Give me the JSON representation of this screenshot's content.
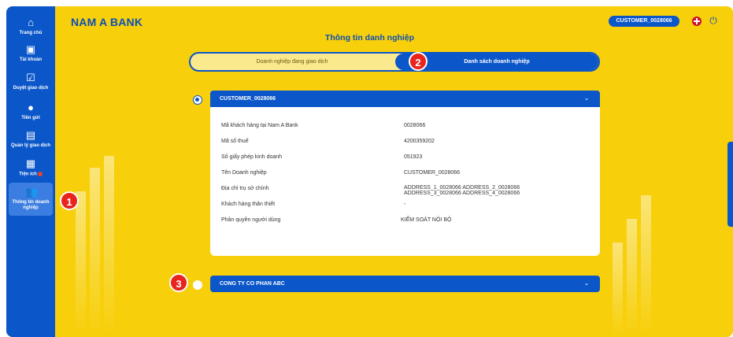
{
  "sidebar": {
    "items": [
      {
        "label": "Trang chủ",
        "icon": "home-icon"
      },
      {
        "label": "Tài khoản",
        "icon": "wallet-icon"
      },
      {
        "label": "Duyệt giao dịch",
        "icon": "approve-icon"
      },
      {
        "label": "Tiền gửi",
        "icon": "piggy-bank-icon"
      },
      {
        "label": "Quản lý giao dịch",
        "icon": "transaction-icon"
      },
      {
        "label": "Tiện ích",
        "icon": "grid-icon"
      },
      {
        "label": "Thông tin doanh nghiệp",
        "icon": "people-icon"
      }
    ]
  },
  "header": {
    "logo": "NAM A BANK",
    "customer_id": "CUSTOMER_0028066",
    "language_icon": "uk-flag-icon",
    "power_icon": "power-icon"
  },
  "page": {
    "title": "Thông tin danh nghiệp"
  },
  "tabs": {
    "left": "Doanh nghiệp đang giao dịch",
    "right": "Danh sách doanh nghiệp"
  },
  "companies": [
    {
      "name": "CUSTOMER_0028066",
      "selected": true,
      "details": [
        {
          "label": "Mã khách hàng tại Nam A Bank",
          "value": "0028066"
        },
        {
          "label": "Mã số thuế",
          "value": "4200359202"
        },
        {
          "label": "Số giấy phép kinh doanh",
          "value": "051923"
        },
        {
          "label": "Tên Doanh nghiệp",
          "value": "CUSTOMER_0028066"
        },
        {
          "label": "Địa chỉ trụ sở chính",
          "value": "ADDRESS_1_0028066 ADDRESS_2_0028066",
          "value2": "ADDRESS_3_0028066 ADDRESS_4_0028066"
        },
        {
          "label": "Khách hàng thân thiết",
          "value": "-"
        },
        {
          "label": "Phân quyền người dùng",
          "value": "KIỂM SOÁT NỘI BỘ"
        }
      ]
    },
    {
      "name": "CONG TY CO PHAN ABC",
      "selected": false
    }
  ],
  "steps": [
    "1",
    "2",
    "3"
  ],
  "colors": {
    "primary_blue": "#0b56c9",
    "background_yellow": "#f7cf0a",
    "step_red": "#e8241c"
  }
}
